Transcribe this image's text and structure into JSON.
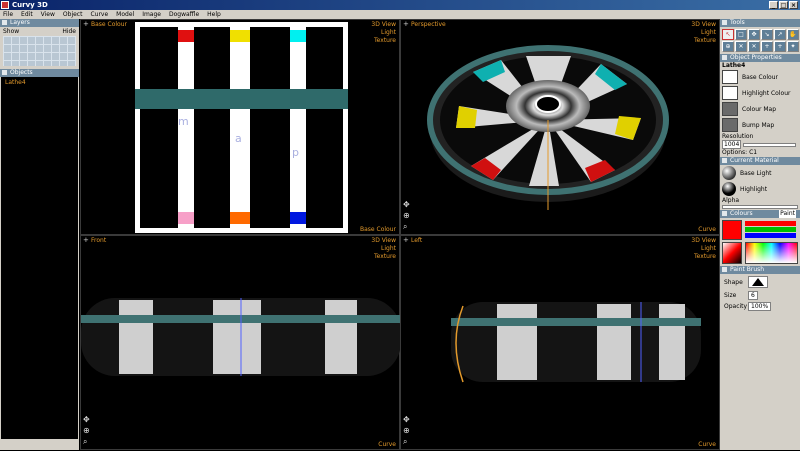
{
  "window": {
    "title": "Curvy 3D",
    "controls": [
      "_",
      "□",
      "×"
    ]
  },
  "menu": [
    "File",
    "Edit",
    "View",
    "Object",
    "Curve",
    "Model",
    "Image",
    "Dogwaffle",
    "Help"
  ],
  "left": {
    "layers": {
      "header": "Layers",
      "show_label": "Show",
      "hide_label": "Hide"
    },
    "objects": {
      "header": "Objects",
      "items": [
        "Lathe4"
      ]
    }
  },
  "viewports": {
    "base_colour": {
      "title": "Base Colour",
      "menu": [
        "3D View",
        "Light",
        "Texture"
      ],
      "bottom": "Base Colour"
    },
    "perspective": {
      "title": "Perspective",
      "menu": [
        "3D View",
        "Light",
        "Texture"
      ],
      "bottom": "Curve"
    },
    "front": {
      "title": "Front",
      "menu": [
        "3D View",
        "Light",
        "Texture"
      ],
      "bottom": "Curve"
    },
    "left": {
      "title": "Left",
      "menu": [
        "3D View",
        "Light",
        "Texture"
      ],
      "bottom": "Curve"
    }
  },
  "texture": {
    "letters": [
      "m",
      "a",
      "p"
    ],
    "top_colors": [
      "#e01010",
      "#f0e000",
      "#00f0f0"
    ],
    "bottom_colors": [
      "#f7a0c8",
      "#ff6a00",
      "#0018e0"
    ],
    "band_color": "#2f6a6a"
  },
  "right": {
    "tools_header": "Tools",
    "tools": [
      "↖",
      "□",
      "✥",
      "↘",
      "↗",
      "✋",
      "⊕",
      "✕",
      "✕",
      "+",
      "+",
      "✦"
    ],
    "props_header": "Object Properties",
    "object_name": "Lathe4",
    "base_colour": "Base Colour",
    "highlight_colour": "Highlight Colour",
    "colour_map": "Colour Map",
    "bump_map": "Bump Map",
    "resolution_label": "Resolution",
    "resolution_value": "1004",
    "options_label": "Options: C1",
    "material_header": "Current Material",
    "base_light": "Base Light",
    "highlight": "Highlight",
    "alpha": "Alpha",
    "colours_header": "Colours",
    "colours_mode": "Paint",
    "current_colour": "#ff0000",
    "paint_header": "Paint Brush",
    "shape_label": "Shape",
    "size_label": "Size",
    "size_value": "6",
    "opacity_label": "Opacity",
    "opacity_value": "100%"
  }
}
